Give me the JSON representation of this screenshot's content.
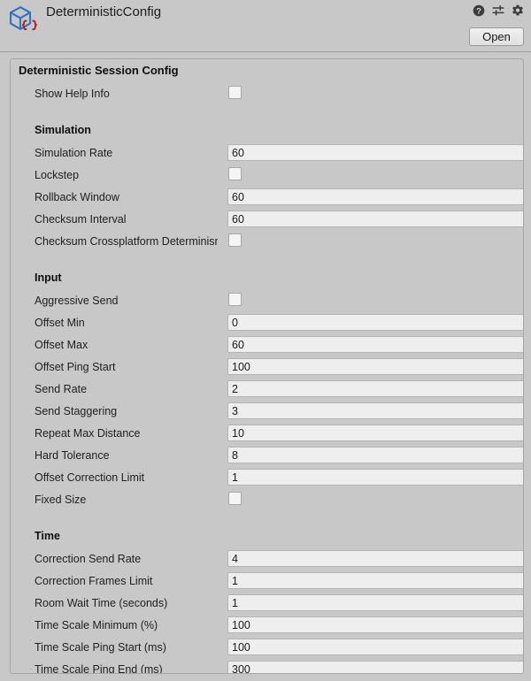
{
  "header": {
    "title": "DeterministicConfig",
    "icon": "scriptable-object-icon",
    "help_icon": "help-icon",
    "preset_icon": "preset-icon",
    "gear_icon": "gear-icon",
    "open_label": "Open"
  },
  "panel": {
    "title": "Deterministic Session Config",
    "rows": [
      {
        "type": "toggle",
        "label": "Show Help Info",
        "checked": false
      },
      {
        "type": "spacer"
      },
      {
        "type": "section",
        "label": "Simulation"
      },
      {
        "type": "text",
        "label": "Simulation Rate",
        "value": "60"
      },
      {
        "type": "toggle",
        "label": "Lockstep",
        "checked": false
      },
      {
        "type": "text",
        "label": "Rollback Window",
        "value": "60"
      },
      {
        "type": "text",
        "label": "Checksum Interval",
        "value": "60"
      },
      {
        "type": "toggle",
        "label": "Checksum Crossplatform Determinism",
        "checked": false
      },
      {
        "type": "spacer"
      },
      {
        "type": "section",
        "label": "Input"
      },
      {
        "type": "toggle",
        "label": "Aggressive Send",
        "checked": false
      },
      {
        "type": "text",
        "label": "Offset Min",
        "value": "0"
      },
      {
        "type": "text",
        "label": "Offset Max",
        "value": "60"
      },
      {
        "type": "text",
        "label": "Offset Ping Start",
        "value": "100"
      },
      {
        "type": "text",
        "label": "Send Rate",
        "value": "2"
      },
      {
        "type": "text",
        "label": "Send Staggering",
        "value": "3"
      },
      {
        "type": "text",
        "label": "Repeat Max Distance",
        "value": "10"
      },
      {
        "type": "text",
        "label": "Hard Tolerance",
        "value": "8"
      },
      {
        "type": "text",
        "label": "Offset Correction Limit",
        "value": "1"
      },
      {
        "type": "toggle",
        "label": "Fixed Size",
        "checked": false
      },
      {
        "type": "spacer"
      },
      {
        "type": "section",
        "label": "Time"
      },
      {
        "type": "text",
        "label": "Correction Send Rate",
        "value": "4"
      },
      {
        "type": "text",
        "label": "Correction Frames Limit",
        "value": "1"
      },
      {
        "type": "text",
        "label": "Room Wait Time (seconds)",
        "value": "1"
      },
      {
        "type": "text",
        "label": "Time Scale Minimum (%)",
        "value": "100"
      },
      {
        "type": "text",
        "label": "Time Scale Ping Start (ms)",
        "value": "100"
      },
      {
        "type": "text",
        "label": "Time Scale Ping End (ms)",
        "value": "300"
      }
    ]
  },
  "colors": {
    "window_background": "#c8c8c8",
    "field_background": "#eeeeee",
    "field_border": "#b4b4b4",
    "panel_border": "#a6a6a6",
    "icon_cube_blue": "#2f74c0",
    "icon_braces_red": "#b32222",
    "text": "#202020"
  }
}
